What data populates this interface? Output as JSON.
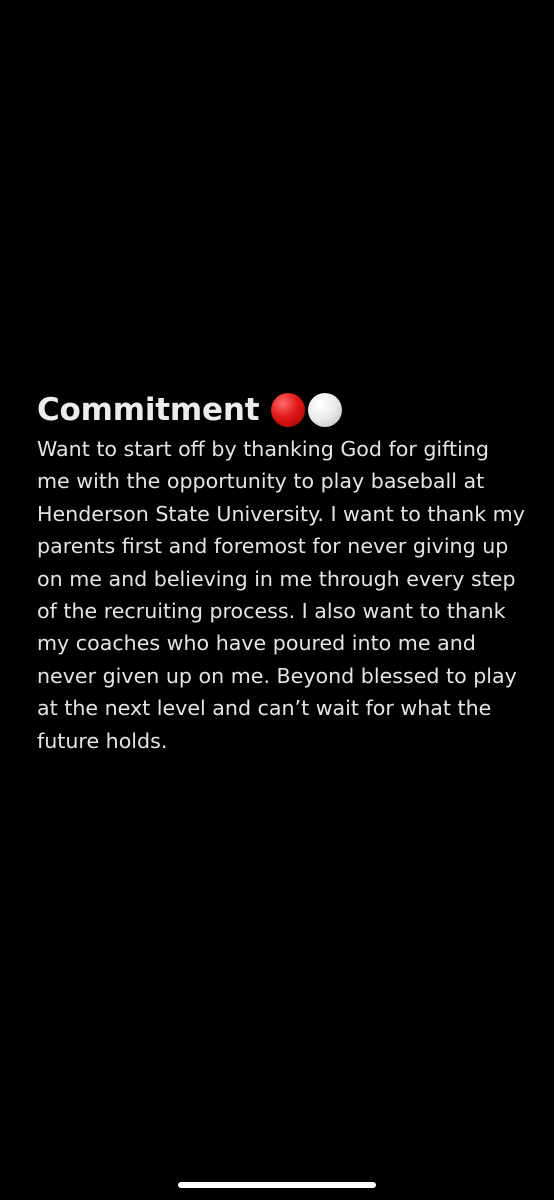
{
  "note": {
    "title": "Commitment",
    "title_icons": [
      {
        "icon": "red-circle-icon",
        "color": "#e01818"
      },
      {
        "icon": "white-circle-icon",
        "color": "#ffffff"
      }
    ],
    "lines": [
      "Want to start off by thanking God for gifting",
      "me with the opportunity to play baseball at",
      "Henderson State University. I want to thank my",
      "parents first and foremost for never giving up",
      "on me and believing in me through every step",
      "of the recruiting process. I also want to thank",
      "my coaches who have poured into me and",
      "never given up on me. Beyond blessed to play",
      "at the next level and can’t wait for what the",
      "future holds."
    ]
  },
  "colors": {
    "background": "#000000",
    "text": "#e4e4e4"
  }
}
